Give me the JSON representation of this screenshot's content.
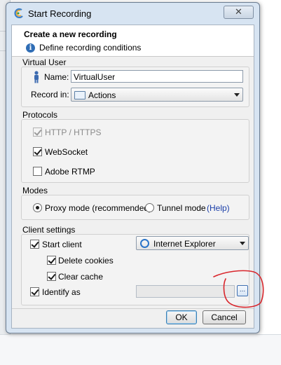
{
  "dialog": {
    "title": "Start Recording",
    "close_label": "✕",
    "header": {
      "title": "Create a new recording",
      "subtitle": "Define recording conditions"
    },
    "virtual_user": {
      "section_label": "Virtual User",
      "name_label": "Name:",
      "name_value": "VirtualUser",
      "record_in_label": "Record in:",
      "record_in_value": "Actions"
    },
    "protocols": {
      "section_label": "Protocols",
      "items": [
        {
          "label": "HTTP / HTTPS",
          "checked": true,
          "disabled": true
        },
        {
          "label": "WebSocket",
          "checked": true,
          "disabled": false
        },
        {
          "label": "Adobe RTMP",
          "checked": false,
          "disabled": false
        }
      ]
    },
    "modes": {
      "section_label": "Modes",
      "proxy_label": "Proxy mode (recommended)",
      "tunnel_label": "Tunnel mode",
      "help_label": "(Help)",
      "selected": "proxy"
    },
    "client_settings": {
      "section_label": "Client settings",
      "start_client_label": "Start client",
      "browser_value": "Internet Explorer",
      "delete_cookies_label": "Delete cookies",
      "clear_cache_label": "Clear cache",
      "identify_as_label": "Identify as",
      "identify_as_value": "",
      "browse_label": "..."
    },
    "buttons": {
      "ok": "OK",
      "cancel": "Cancel"
    }
  },
  "colors": {
    "annotation": "#d9262c",
    "link": "#1a3ea8",
    "frame": "#d7e4f2"
  }
}
